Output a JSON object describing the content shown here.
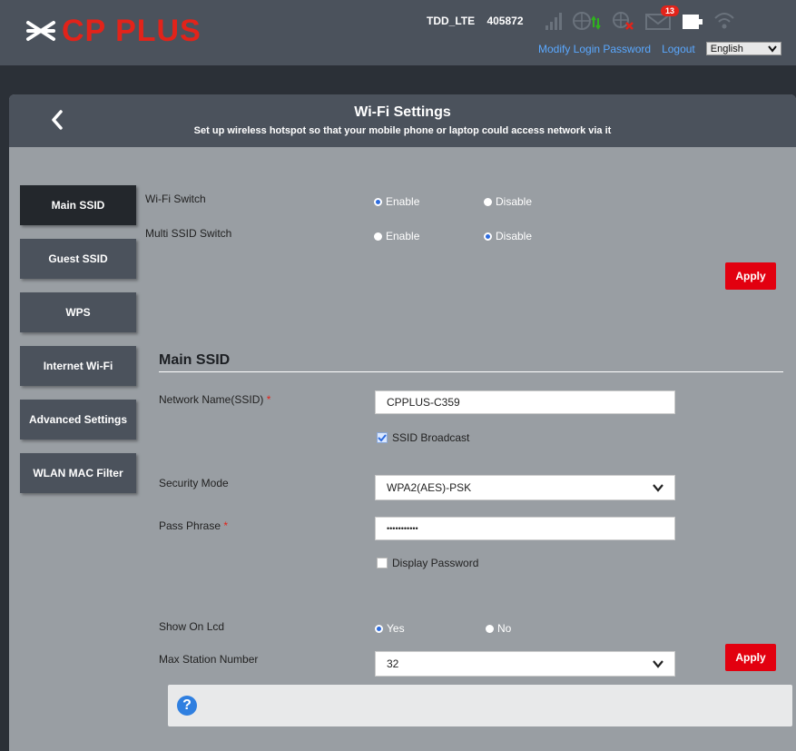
{
  "header": {
    "logo_text": "CP PLUS",
    "network_type": "TDD_LTE",
    "network_id": "405872",
    "message_count": "13",
    "modify_password_label": "Modify Login Password",
    "logout_label": "Logout",
    "language_value": "English"
  },
  "page": {
    "title": "Wi-Fi Settings",
    "subtitle": "Set up wireless hotspot so that your mobile phone or laptop could access network via it"
  },
  "sidebar": {
    "items": [
      {
        "label": "Main SSID",
        "active": true
      },
      {
        "label": "Guest SSID",
        "active": false
      },
      {
        "label": "WPS",
        "active": false
      },
      {
        "label": "Internet Wi-Fi",
        "active": false
      },
      {
        "label": "Advanced Settings",
        "active": false
      },
      {
        "label": "WLAN MAC Filter",
        "active": false
      }
    ]
  },
  "switches": {
    "wifi_switch_label": "Wi-Fi Switch",
    "multi_ssid_label": "Multi SSID Switch",
    "enable_label": "Enable",
    "disable_label": "Disable",
    "wifi_switch_value": "Enable",
    "multi_ssid_value": "Disable",
    "apply_label": "Apply"
  },
  "main_ssid": {
    "section_title": "Main SSID",
    "network_name_label": "Network Name(SSID)",
    "required_mark": "*",
    "network_name_value": "CPPLUS-C359",
    "ssid_broadcast_label": "SSID Broadcast",
    "ssid_broadcast_checked": true,
    "security_mode_label": "Security Mode",
    "security_mode_value": "WPA2(AES)-PSK",
    "pass_phrase_label": "Pass Phrase",
    "pass_phrase_value": "•••••••••••",
    "display_password_label": "Display Password",
    "display_password_checked": false,
    "show_on_lcd_label": "Show On Lcd",
    "yes_label": "Yes",
    "no_label": "No",
    "show_on_lcd_value": "Yes",
    "max_station_label": "Max Station Number",
    "max_station_value": "32",
    "apply_label": "Apply"
  },
  "help": {
    "icon": "question-icon"
  },
  "colors": {
    "accent_red": "#e2000f",
    "header_bg": "#4b525c",
    "panel_bg": "#999ea3",
    "link_blue": "#5aa8ff"
  }
}
